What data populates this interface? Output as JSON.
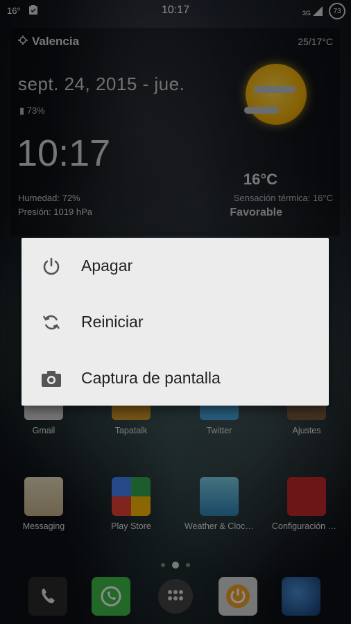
{
  "status_bar": {
    "temp_icon_text": "16°",
    "time": "10:17",
    "network": "3G",
    "battery_level": "73"
  },
  "widget": {
    "location": "Valencia",
    "temp_range": "25/17°C",
    "date": "sept. 24, 2015 - jue.",
    "battery": "73%",
    "clock": "10:17",
    "humidity": "Humedad: 72%",
    "pressure": "Presión: 1019 hPa",
    "temperature": "16°C",
    "feels_like": "Sensación térmica: 16°C",
    "condition": "Favorable"
  },
  "dialog": {
    "options": [
      {
        "label": "Apagar",
        "icon": "power-icon"
      },
      {
        "label": "Reiniciar",
        "icon": "restart-icon"
      },
      {
        "label": "Captura de pantalla",
        "icon": "camera-icon"
      }
    ]
  },
  "home": {
    "row1": [
      {
        "label": "Gmail"
      },
      {
        "label": "Tapatalk"
      },
      {
        "label": "Twitter"
      },
      {
        "label": "Ajustes"
      }
    ],
    "row2": [
      {
        "label": "Messaging"
      },
      {
        "label": "Play Store"
      },
      {
        "label": "Weather & Clock Wi..."
      },
      {
        "label": "Configuración de No..."
      }
    ]
  },
  "dock": {
    "items": [
      "phone-icon",
      "whatsapp-icon",
      "app-drawer-icon",
      "power-toggle-icon",
      "browser-globe-icon"
    ]
  },
  "colors": {
    "dialog_bg": "#ececec",
    "dialog_text": "#222222",
    "sun": "#f5b20a"
  }
}
